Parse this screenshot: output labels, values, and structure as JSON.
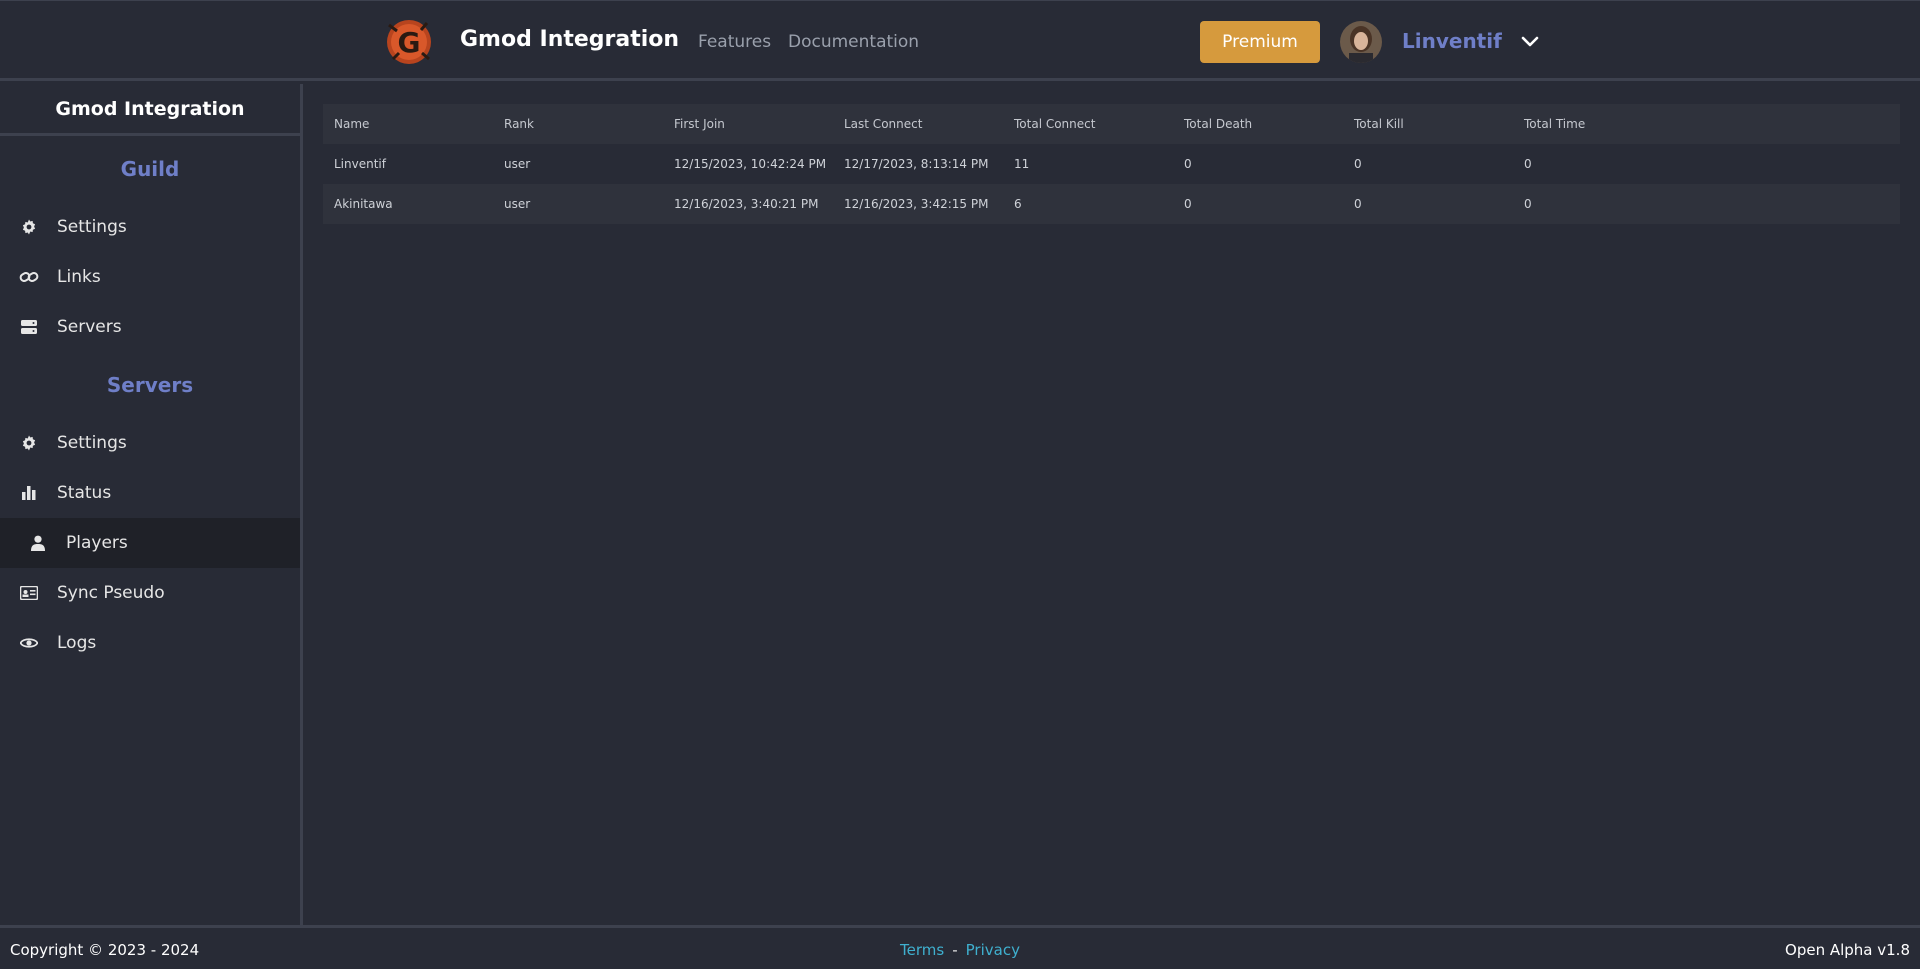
{
  "header": {
    "brand": "Gmod Integration",
    "nav": [
      "Features",
      "Documentation"
    ],
    "premium_label": "Premium",
    "username": "Linventif"
  },
  "sidebar": {
    "title": "Gmod Integration",
    "guild_title": "Guild",
    "guild_items": [
      {
        "label": "Settings",
        "icon": "gear-icon"
      },
      {
        "label": "Links",
        "icon": "link-icon"
      },
      {
        "label": "Servers",
        "icon": "server-icon"
      }
    ],
    "servers_title": "Servers",
    "server_items": [
      {
        "label": "Settings",
        "icon": "gear-icon"
      },
      {
        "label": "Status",
        "icon": "bar-chart-icon"
      },
      {
        "label": "Players",
        "icon": "user-icon",
        "active": true
      },
      {
        "label": "Sync Pseudo",
        "icon": "id-card-icon"
      },
      {
        "label": "Logs",
        "icon": "eye-icon"
      }
    ]
  },
  "table": {
    "headers": [
      "Name",
      "Rank",
      "First Join",
      "Last Connect",
      "Total Connect",
      "Total Death",
      "Total Kill",
      "Total Time"
    ],
    "rows": [
      [
        "Linventif",
        "user",
        "12/15/2023, 10:42:24 PM",
        "12/17/2023, 8:13:14 PM",
        "11",
        "0",
        "0",
        "0"
      ],
      [
        "Akinitawa",
        "user",
        "12/16/2023, 3:40:21 PM",
        "12/16/2023, 3:42:15 PM",
        "6",
        "0",
        "0",
        "0"
      ]
    ]
  },
  "footer": {
    "copyright": "Copyright © 2023 - 2024",
    "terms": "Terms",
    "separator": "-",
    "privacy": "Privacy",
    "version": "Open Alpha v1.8"
  },
  "colors": {
    "background": "#282b36",
    "accent": "#6f7fc8",
    "premium": "#d69a3d",
    "link": "#3fb0cf"
  }
}
